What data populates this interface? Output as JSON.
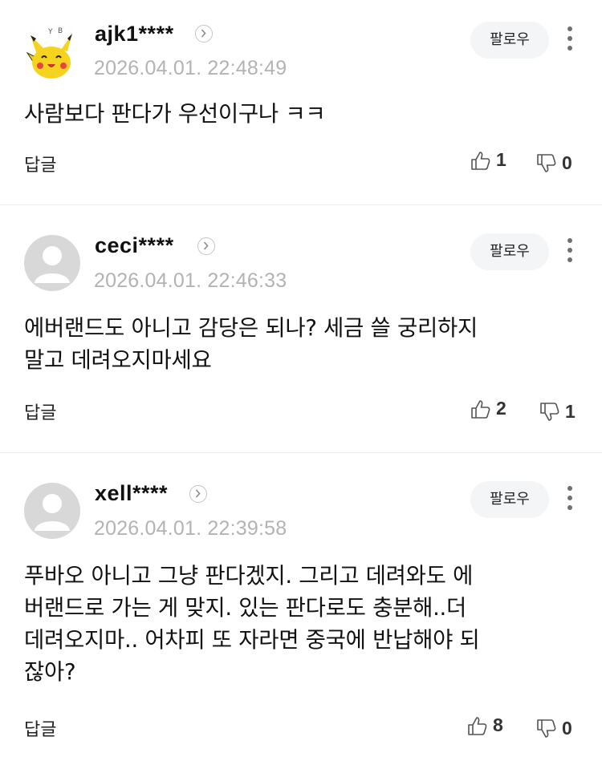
{
  "comments": [
    {
      "username": "ajk1****",
      "timestamp": "2026.04.01. 22:48:49",
      "follow_label": "팔로우",
      "text_lines": [
        "사람보다 판다가 우선이구나 ㅋㅋ"
      ],
      "reply_label": "답글",
      "likes": "1",
      "dislikes": "0",
      "avatar": "pikachu-avatar"
    },
    {
      "username": "ceci****",
      "timestamp": "2026.04.01. 22:46:33",
      "follow_label": "팔로우",
      "text_lines": [
        "에버랜드도 아니고 감당은 되나? 세금 쓸 궁리하지",
        "말고 데려오지마세요"
      ],
      "reply_label": "답글",
      "likes": "2",
      "dislikes": "1",
      "avatar": "default-avatar"
    },
    {
      "username": "xell****",
      "timestamp": "2026.04.01. 22:39:58",
      "follow_label": "팔로우",
      "text_lines": [
        "푸바오 아니고 그냥 판다겠지. 그리고 데려와도 에",
        "버랜드로 가는 게 맞지. 있는 판다로도 충분해..더",
        "데려오지마.. 어차피 또 자라면 중국에 반납해야 되",
        "잖아?"
      ],
      "reply_label": "답글",
      "likes": "8",
      "dislikes": "0",
      "avatar": "default-avatar"
    }
  ],
  "colors": {
    "timestamp": "#b3b3b3",
    "follow_bg": "#f4f5f6",
    "avatar_default": "#d8d8d8",
    "divider": "#ececec"
  }
}
